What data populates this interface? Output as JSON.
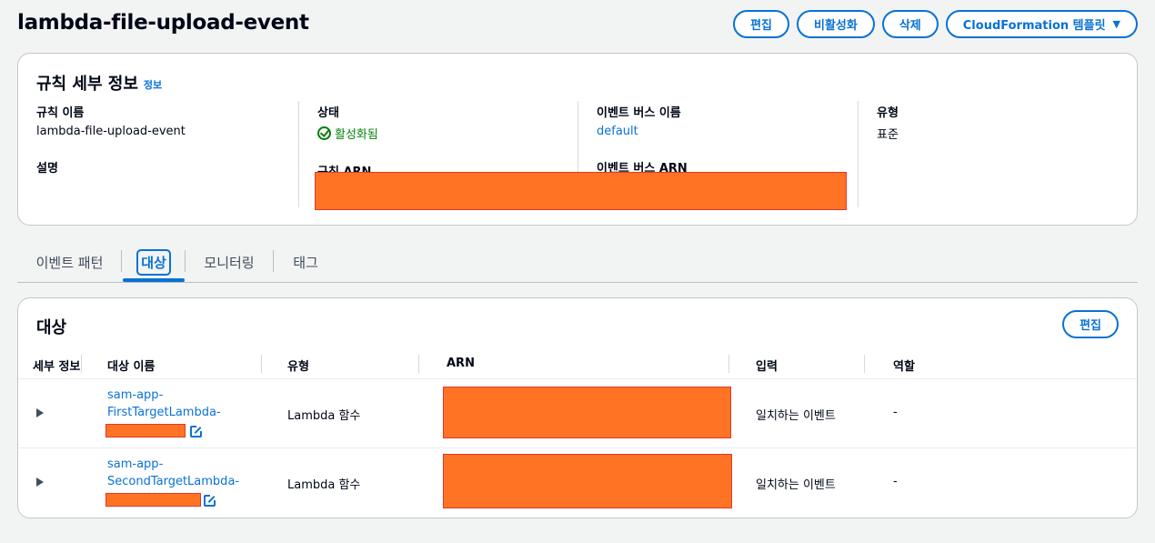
{
  "header": {
    "title": "lambda-file-upload-event",
    "actions": {
      "edit": "편집",
      "disable": "비활성화",
      "delete": "삭제",
      "cloudformation": "CloudFormation 템플릿",
      "cloudformation_caret": "▼"
    }
  },
  "rule_details": {
    "title": "규칙 세부 정보",
    "info": "정보",
    "rule_name_label": "규칙 이름",
    "rule_name": "lambda-file-upload-event",
    "description_label": "설명",
    "status_label": "상태",
    "status": "활성화됨",
    "rule_arn_label": "규칙 ARN",
    "event_bus_name_label": "이벤트 버스 이름",
    "event_bus_name": "default",
    "event_bus_arn_label": "이벤트 버스 ARN",
    "type_label": "유형",
    "type": "표준"
  },
  "tabs": [
    {
      "label": "이벤트 패턴"
    },
    {
      "label": "대상"
    },
    {
      "label": "모니터링"
    },
    {
      "label": "태그"
    }
  ],
  "targets": {
    "title": "대상",
    "edit": "편집",
    "columns": [
      "세부 정보",
      "대상 이름",
      "유형",
      "ARN",
      "입력",
      "역할"
    ],
    "rows": [
      {
        "name_line1": "sam-app-",
        "name_line2": "FirstTargetLambda-",
        "type": "Lambda 함수",
        "input": "일치하는 이벤트",
        "role": "-"
      },
      {
        "name_line1": "sam-app-",
        "name_line2": "SecondTargetLambda-",
        "type": "Lambda 함수",
        "input": "일치하는 이벤트",
        "role": "-"
      }
    ]
  },
  "colors": {
    "accent": "#0972d3",
    "success": "#037f0c",
    "redaction": "#ff7324"
  }
}
